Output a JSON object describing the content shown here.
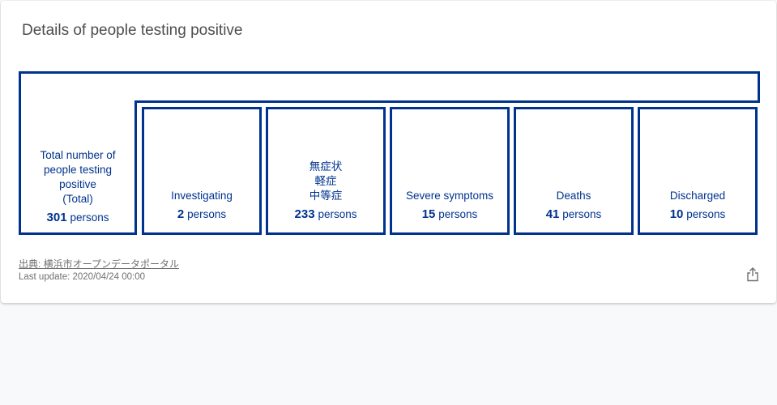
{
  "card": {
    "title": "Details of people testing positive"
  },
  "total": {
    "label": "Total number of\npeople testing\npositive\n(Total)",
    "value": "301",
    "unit": "persons"
  },
  "breakdown": [
    {
      "label": "Investigating",
      "value": "2",
      "unit": "persons"
    },
    {
      "label": "無症状\n軽症\n中等症",
      "value": "233",
      "unit": "persons"
    },
    {
      "label": "Severe symptoms",
      "value": "15",
      "unit": "persons"
    },
    {
      "label": "Deaths",
      "value": "41",
      "unit": "persons"
    },
    {
      "label": "Discharged",
      "value": "10",
      "unit": "persons"
    }
  ],
  "footer": {
    "source_link": "出典: 横浜市オープンデータポータル",
    "last_update": "Last update: 2020/04/24 00:00"
  },
  "icons": {
    "share": "share-icon"
  },
  "colors": {
    "accent": "#00338d",
    "title_text": "#4d4d4d",
    "muted_text": "#707070"
  }
}
